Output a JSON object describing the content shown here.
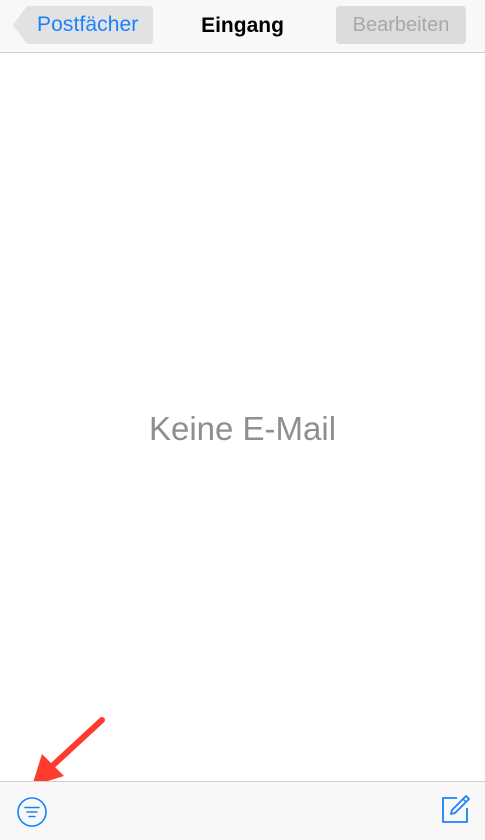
{
  "navbar": {
    "back_label": "Postfächer",
    "title": "Eingang",
    "edit_label": "Bearbeiten"
  },
  "main": {
    "empty_message": "Keine E-Mail"
  },
  "toolbar": {
    "filter_icon": "filter-icon",
    "compose_icon": "compose-icon"
  },
  "annotation": {
    "arrow_icon": "red-arrow-icon",
    "arrow_color": "#ff3b30"
  },
  "colors": {
    "accent": "#1a82fb",
    "bar_background": "#f8f8f8",
    "disabled_text": "#a8a8a8",
    "empty_text": "#8e8e93"
  }
}
